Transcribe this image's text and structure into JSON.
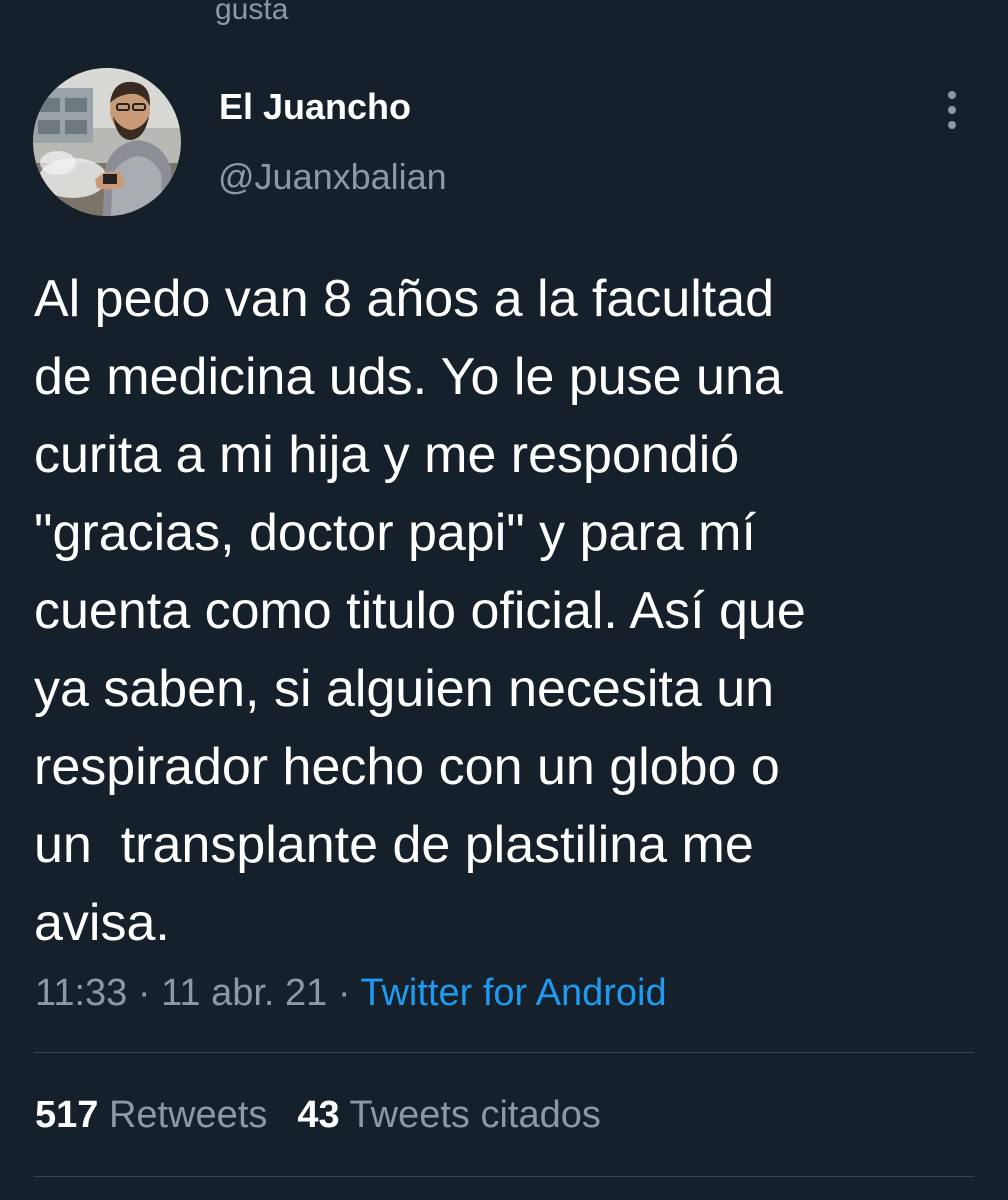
{
  "context": {
    "text": "gusta"
  },
  "author": {
    "display_name": "El Juancho",
    "handle": "@Juanxbalian",
    "avatar_icon": "user-avatar"
  },
  "more_icon": "more-vertical-icon",
  "tweet": {
    "text": "Al pedo van 8 años a la facultad\nde medicina uds. Yo le puse una\ncurita a mi hija y me respondió\n\"gracias, doctor papi\" y para mí\ncuenta como titulo oficial. Así que\nya saben, si alguien necesita un\nrespirador hecho con un globo o\nun  transplante de plastilina me\navisa.",
    "time": "11:33",
    "date": "11 abr. 21",
    "separator": "·",
    "source": "Twitter for Android"
  },
  "stats": {
    "retweets_count": "517",
    "retweets_label": "Retweets",
    "quotes_count": "43",
    "quotes_label": "Tweets citados"
  },
  "colors": {
    "background": "#15202b",
    "primary_text": "#ffffff",
    "secondary_text": "#8b98a5",
    "link": "#1d9bf0",
    "divider": "#38444d"
  }
}
